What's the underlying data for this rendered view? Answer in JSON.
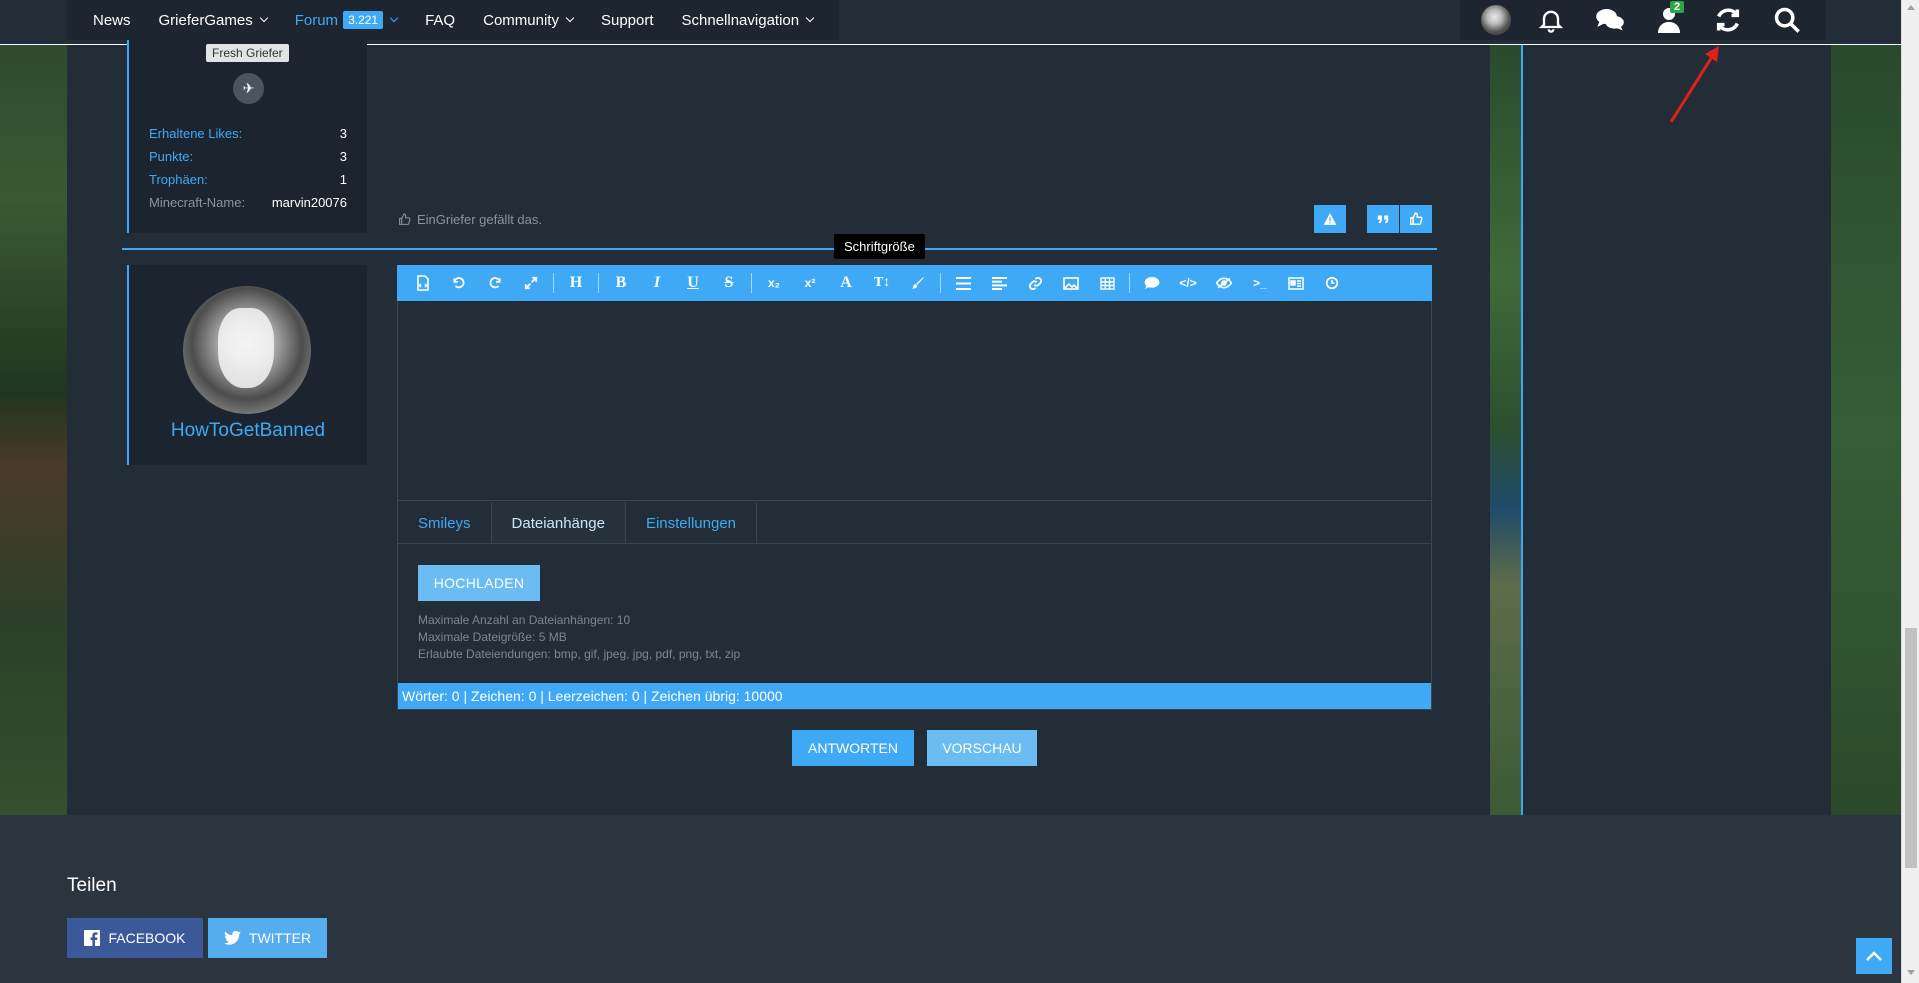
{
  "nav": {
    "items": [
      {
        "label": "News"
      },
      {
        "label": "GrieferGames"
      },
      {
        "label": "Forum",
        "badge": "3.221"
      },
      {
        "label": "FAQ"
      },
      {
        "label": "Community"
      },
      {
        "label": "Support"
      },
      {
        "label": "Schnellnavigation"
      }
    ],
    "notification_badge": "2",
    "icons": [
      "avatar",
      "bell-icon",
      "chat-icon",
      "user-icon",
      "refresh-icon",
      "search-icon"
    ]
  },
  "previous_post": {
    "rank": "Fresh Griefer",
    "stats": [
      {
        "label": "Erhaltene Likes:",
        "value": "3"
      },
      {
        "label": "Punkte:",
        "value": "3"
      },
      {
        "label": "Trophäen:",
        "value": "1"
      },
      {
        "label": "Minecraft-Name:",
        "value": "marvin20076"
      }
    ],
    "likes_text": "EinGriefer gefällt das."
  },
  "tooltip": "Schriftgröße",
  "reply": {
    "username": "HowToGetBanned"
  },
  "editor": {
    "tabs": [
      "Smileys",
      "Dateianhänge",
      "Einstellungen"
    ],
    "upload_label": "HOCHLADEN",
    "info": [
      "Maximale Anzahl an Dateianhängen: 10",
      "Maximale Dateigröße: 5 MB",
      "Erlaubte Dateiendungen: bmp, gif, jpeg, jpg, pdf, png, txt, zip"
    ],
    "status": "Wörter: 0 | Zeichen: 0 | Leerzeichen: 0 | Zeichen übrig: 10000",
    "toolbar_glyphs": {
      "heading": "H",
      "bold": "B",
      "italic": "I",
      "underline": "U",
      "strike": "S",
      "sub": "x₂",
      "sup": "x²",
      "font": "A",
      "size": "T↕",
      "code_inline": "</>",
      "terminal": ">_"
    }
  },
  "actions": {
    "submit": "ANTWORTEN",
    "preview": "VORSCHAU"
  },
  "footer": {
    "share_title": "Teilen",
    "facebook": "FACEBOOK",
    "twitter": "TWITTER"
  },
  "colors": {
    "accent": "#3fa9f5",
    "background": "#232d37",
    "footer": "#2b3540"
  }
}
